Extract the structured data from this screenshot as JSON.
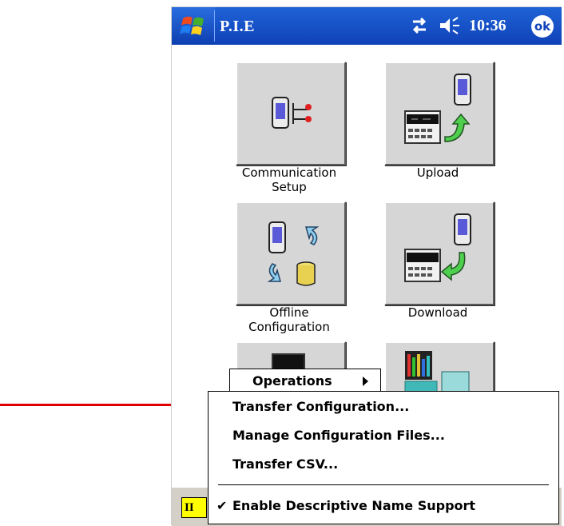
{
  "titlebar": {
    "app_title": "P.I.E",
    "clock": "10:36",
    "ok_label": "ok",
    "start_icon": "windows-flag-icon",
    "status_icons": [
      "connectivity-icon",
      "speaker-icon"
    ]
  },
  "tiles": [
    {
      "label": "Communication\nSetup",
      "icon": "communication-setup-icon"
    },
    {
      "label": "Upload",
      "icon": "upload-icon"
    },
    {
      "label": "Offline\nConfiguration",
      "icon": "offline-configuration-icon"
    },
    {
      "label": "Download",
      "icon": "download-icon"
    },
    {
      "label": "",
      "icon": "device-icon"
    },
    {
      "label": "",
      "icon": "monitor-icon"
    }
  ],
  "menu": {
    "operations_label": "Operations",
    "items": [
      "Transfer Configuration...",
      "Manage Configuration Files...",
      "Transfer CSV..."
    ],
    "checked_item": "Enable Descriptive Name Support",
    "check_mark": "✔"
  },
  "taskbar": {
    "button_label": "II"
  },
  "colors": {
    "titlebar": "#1041b8",
    "annotation_arrow": "#e00000",
    "tile_face": "#d6d6d6",
    "taskbar_highlight": "#ffff00"
  }
}
